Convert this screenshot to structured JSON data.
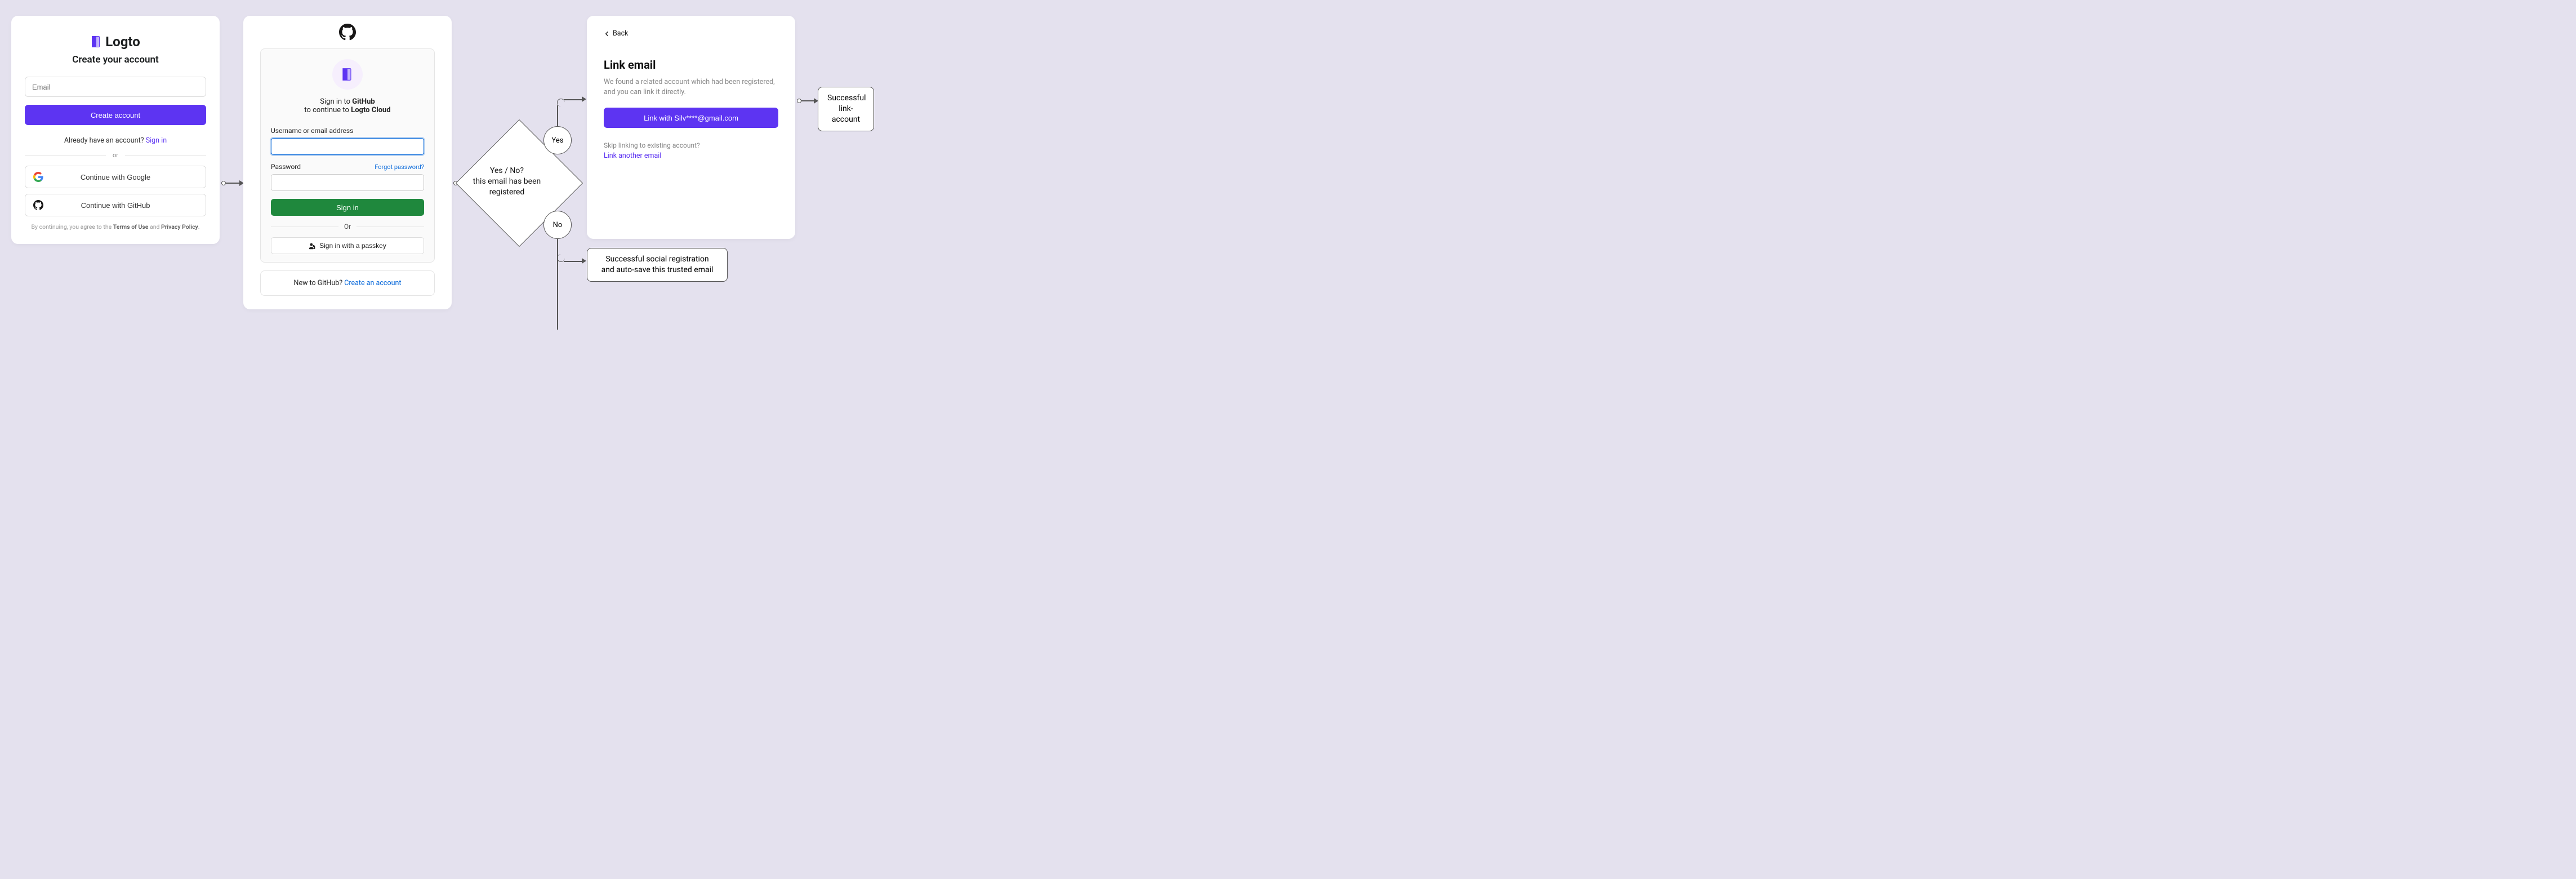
{
  "signup": {
    "brand": "Logto",
    "heading": "Create your account",
    "email_placeholder": "Email",
    "create_btn": "Create account",
    "already_text": "Already have an account?",
    "signin_link": "Sign in",
    "or": "or",
    "google_btn": "Continue with Google",
    "github_btn": "Continue with GitHub",
    "terms_prefix": "By continuing, you agree to the ",
    "terms_of_use": "Terms of Use",
    "terms_and": " and ",
    "privacy_policy": "Privacy Policy",
    "terms_suffix": "."
  },
  "github": {
    "signin_prefix": "Sign in to ",
    "signin_app": "GitHub",
    "continue_prefix": "to continue to ",
    "continue_app": "Logto Cloud",
    "username_label": "Username or email address",
    "password_label": "Password",
    "forgot": "Forgot password?",
    "signin_btn": "Sign in",
    "or": "Or",
    "passkey_btn": "Sign in with a passkey",
    "new_prefix": "New to GitHub? ",
    "create_link": "Create an account"
  },
  "flow": {
    "decision_l1": "Yes / No?",
    "decision_l2": "this email has been",
    "decision_l3": "registered",
    "yes": "Yes",
    "no": "No",
    "no_result_l1": "Successful social registration",
    "no_result_l2": "and auto-save this trusted email",
    "final_l1": "Successful",
    "final_l2": "link-account"
  },
  "link": {
    "back": "Back",
    "title": "Link email",
    "desc": "We found a related account which had been registered, and you can link it directly.",
    "link_btn": "Link with Silv****@gmail.com",
    "skip_q": "Skip linking to existing account?",
    "another": "Link another email"
  }
}
